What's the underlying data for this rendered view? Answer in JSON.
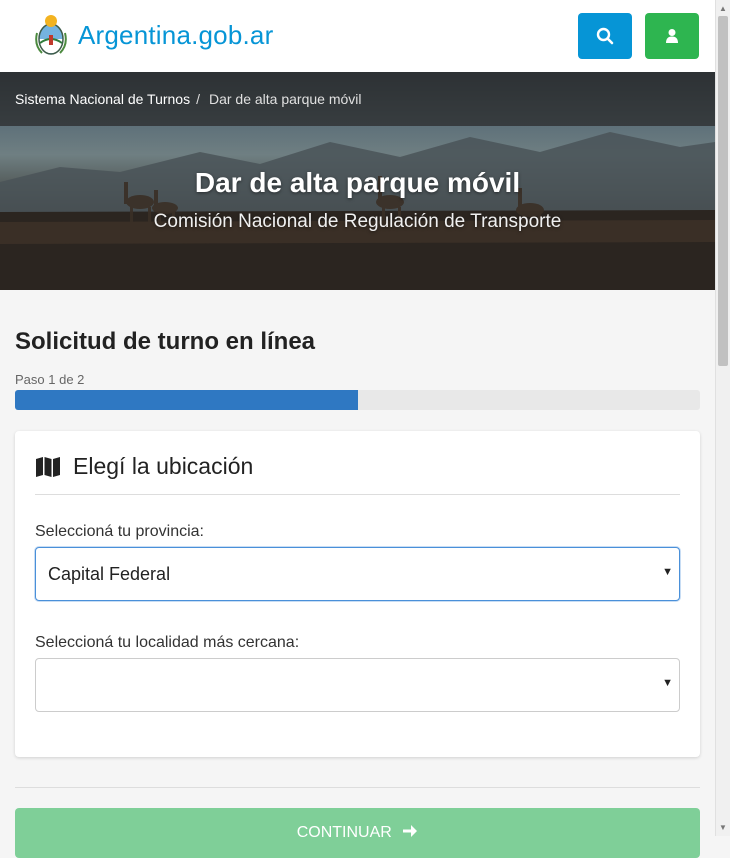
{
  "header": {
    "site_name": "Argentina.gob.ar",
    "search_icon": "search-icon",
    "user_icon": "user-icon",
    "colors": {
      "brand": "#0695d6",
      "search_btn": "#0695d6",
      "user_btn": "#2eb550"
    }
  },
  "breadcrumb": {
    "items": [
      "Sistema Nacional de Turnos",
      "Dar de alta parque móvil"
    ],
    "separator": "/"
  },
  "hero": {
    "title": "Dar de alta parque móvil",
    "subtitle": "Comisión Nacional de Regulación de Transporte"
  },
  "form": {
    "title": "Solicitud de turno en línea",
    "step_label": "Paso 1 de 2",
    "progress": 0.5,
    "progress_color": "#2f78c2"
  },
  "panel": {
    "icon": "map-icon",
    "title": "Elegí la ubicación",
    "province_label": "Seleccioná tu provincia:",
    "province_value": "Capital Federal",
    "locality_label": "Seleccioná tu localidad más cercana:",
    "locality_value": ""
  },
  "actions": {
    "continue_label": "CONTINUAR",
    "continue_icon": "arrow-right-icon",
    "continue_color": "#7fcf98"
  }
}
